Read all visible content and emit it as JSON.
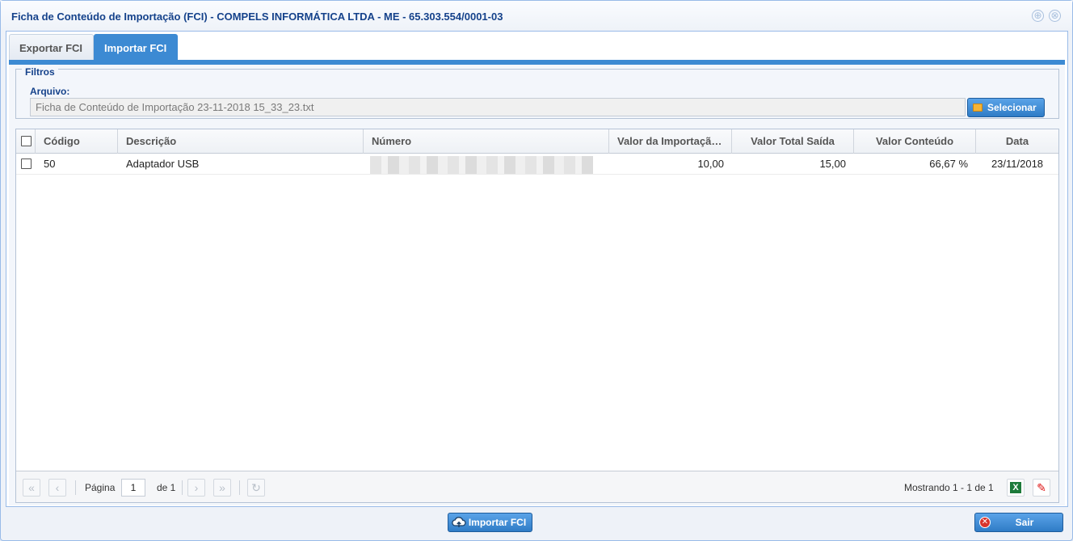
{
  "window": {
    "title": "Ficha de Conteúdo de Importação (FCI) - COMPELS INFORMÁTICA LTDA - ME - 65.303.554/0001-03",
    "tools": {
      "maximize": "⊕",
      "close": "⊗"
    }
  },
  "tabs": [
    {
      "label": "Exportar FCI",
      "active": false
    },
    {
      "label": "Importar FCI",
      "active": true
    }
  ],
  "filtros": {
    "legend": "Filtros",
    "arquivo_label": "Arquivo:",
    "arquivo_value": "Ficha de Conteúdo de Importação 23-11-2018 15_33_23.txt",
    "select_label": "Selecionar"
  },
  "grid": {
    "columns": [
      "Código",
      "Descrição",
      "Número",
      "Valor da Importaçã…",
      "Valor Total Saída",
      "Valor Conteúdo",
      "Data"
    ],
    "rows": [
      {
        "codigo": "50",
        "descricao": "Adaptador USB",
        "numero": "",
        "valor_importacao": "10,00",
        "valor_total_saida": "15,00",
        "valor_conteudo": "66,67 %",
        "data": "23/11/2018"
      }
    ]
  },
  "pager": {
    "first": "«",
    "prev": "‹",
    "next": "›",
    "last": "»",
    "refresh": "↻",
    "page_label": "Página",
    "page_value": "1",
    "of_label": "de 1",
    "showing": "Mostrando 1 - 1 de 1",
    "xls": "X",
    "pdf": "✎"
  },
  "footer": {
    "import_label": "Importar FCI",
    "exit_label": "Sair",
    "exit_icon": "✕"
  },
  "colors": {
    "accent": "#3c8ad3",
    "title": "#15428b"
  }
}
